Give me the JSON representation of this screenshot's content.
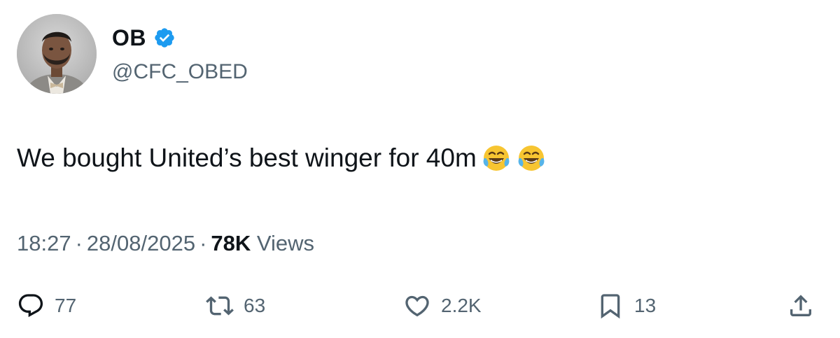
{
  "author": {
    "display_name": "OB",
    "handle": "@CFC_OBED",
    "verified": true,
    "verified_color": "#1d9bf0"
  },
  "tweet": {
    "text": "We bought United’s best winger for 40m",
    "emojis": [
      "face-with-tears-of-joy-icon",
      "face-with-tears-of-joy-icon"
    ]
  },
  "meta": {
    "time": "18:27",
    "separator": "·",
    "date": "28/08/2025",
    "views_count": "78K",
    "views_label": "Views"
  },
  "actions": {
    "replies": {
      "icon": "reply-icon",
      "count": "77"
    },
    "retweets": {
      "icon": "retweet-icon",
      "count": "63"
    },
    "likes": {
      "icon": "heart-icon",
      "count": "2.2K"
    },
    "bookmarks": {
      "icon": "bookmark-icon",
      "count": "13"
    },
    "share": {
      "icon": "share-icon"
    }
  },
  "colors": {
    "text_primary": "#0f1419",
    "text_secondary": "#536471",
    "accent": "#1d9bf0"
  }
}
